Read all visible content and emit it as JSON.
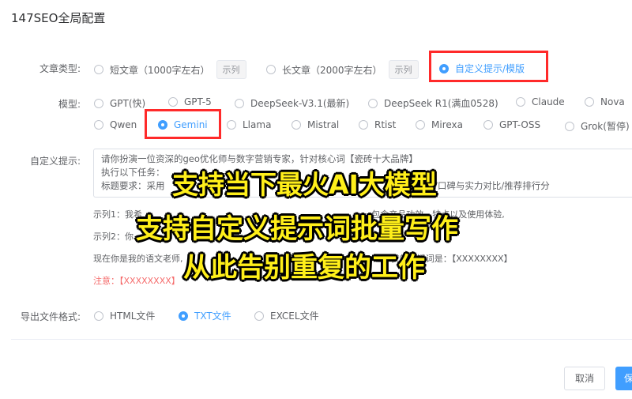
{
  "dialog": {
    "title": "147SEO全局配置"
  },
  "article_type": {
    "label": "文章类型:",
    "options": [
      {
        "label": "短文章（1000字左右）",
        "example": "示列"
      },
      {
        "label": "长文章（2000字左右）",
        "example": "示列"
      },
      {
        "label": "自定义提示/模版"
      }
    ],
    "selected": "自定义提示/模版"
  },
  "model": {
    "label": "模型:",
    "options_row1": [
      "GPT(快)",
      "GPT-5",
      "DeepSeek-V3.1(最新)",
      "DeepSeek R1(满血0528)",
      "Claude",
      "Nova"
    ],
    "options_row2": [
      "Qwen",
      "Gemini",
      "Llama",
      "Mistral",
      "Rtist",
      "Mirexa",
      "GPT-OSS",
      "Grok(暂停)"
    ],
    "selected": "Gemini"
  },
  "custom_prompt": {
    "label": "自定义提示:",
    "lines": [
      "请你扮演一位资深的geo优化师与数字营销专家，针对核心词【瓷砖十大品牌】",
      "执行以下任务：",
      "标题要求：采用                                                                                    名解析/口碑与实力对比/推荐排行分"
    ]
  },
  "hints": {
    "example1": "示列1：我希                                                                                   包含产品功效、特点以及使用体验,",
    "example2": "示列2：你                                                                                    的小说。",
    "example3": "现在你是我的语文老师,                                                                     趣，我的关键词是：【XXXXXXXX】",
    "warning": "注意：【XXXXXXXX】"
  },
  "overlay": {
    "line1": "支持当下最火AI大模型",
    "line2": "支持自定义提示词批量写作",
    "line3": "从此告别重复的工作"
  },
  "export_format": {
    "label": "导出文件格式:",
    "options": [
      "HTML文件",
      "TXT文件",
      "EXCEL文件"
    ],
    "selected": "TXT文件"
  },
  "footer": {
    "cancel_label": "取消",
    "save_label": "保"
  },
  "colors": {
    "primary": "#409eff",
    "highlight_box": "#ff2a2a",
    "overlay_text": "#ffef1a"
  }
}
